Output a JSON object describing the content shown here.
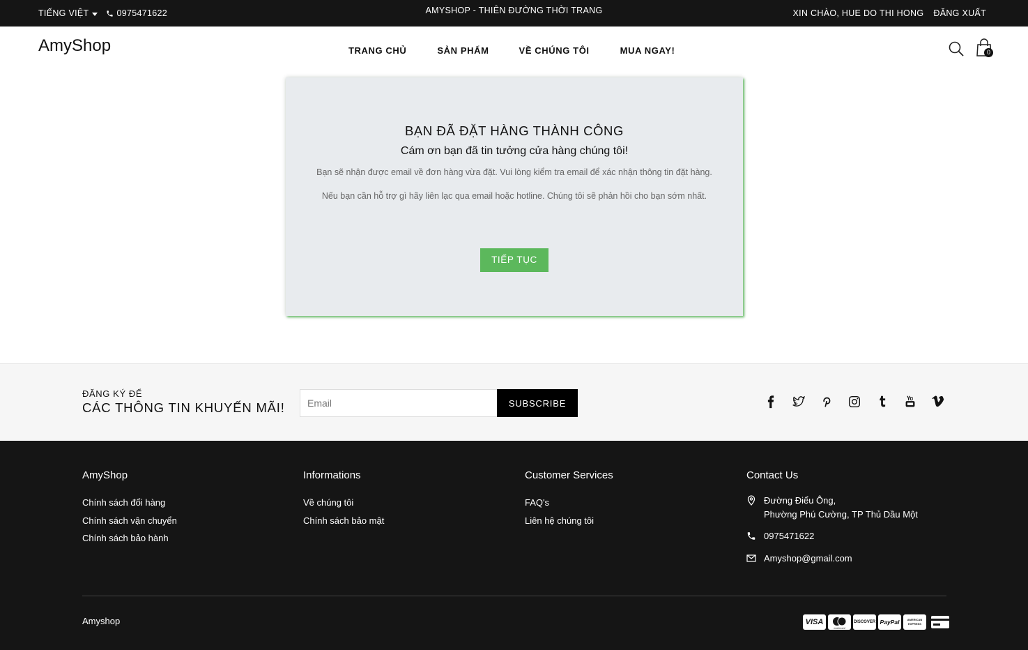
{
  "topbar": {
    "language": "TIẾNG VIỆT",
    "phone": "0975471622",
    "tagline": "AMYSHOP - THIÊN ĐƯỜNG THỜI TRANG",
    "greeting": "XIN CHÀO, HUE DO THI HONG",
    "logout": "ĐĂNG XUẤT"
  },
  "header": {
    "logo": "AmyShop",
    "nav": [
      "TRANG CHỦ",
      "SẢN PHẨM",
      "VỀ CHÚNG TÔI",
      "MUA NGAY!"
    ],
    "cart_count": "0",
    "icons": {
      "search": "search-icon",
      "cart": "shopping-bag-icon"
    }
  },
  "success": {
    "title": "BẠN ĐÃ ĐẶT HÀNG THÀNH CÔNG",
    "thanks": "Cám ơn bạn đã tin tưởng cửa hàng chúng tôi!",
    "message1": "Bạn sẽ nhận được email về đơn hàng vừa đặt. Vui lòng kiểm tra email để xác nhận thông tin đặt hàng.",
    "message2": "Nếu bạn cần hỗ trợ gì hãy liên lạc qua email hoặc hotline. Chúng tôi sẽ phản hồi cho bạn sớm nhất.",
    "button": "TIẾP TỤC",
    "accent_color": "#5cb85c"
  },
  "newsletter": {
    "small_text": "ĐĂNG KÝ ĐỂ",
    "big_text": "CÁC THÔNG TIN KHUYẾN MÃI!",
    "placeholder": "Email",
    "button": "SUBSCRIBE",
    "socials": [
      "facebook-icon",
      "twitter-icon",
      "pinterest-icon",
      "instagram-icon",
      "tumblr-icon",
      "youtube-icon",
      "vimeo-icon"
    ]
  },
  "footer": {
    "col1": {
      "title": "AmyShop",
      "links": [
        "Chính sách đổi hàng",
        "Chính sách vận chuyển",
        "Chính sách bảo hành"
      ]
    },
    "col2": {
      "title": "Informations",
      "links": [
        "Về chúng tôi",
        "Chính sách bảo mật"
      ]
    },
    "col3": {
      "title": "Customer Services",
      "links": [
        "FAQ's",
        "Liên hệ chúng tôi"
      ]
    },
    "contact": {
      "title": "Contact Us",
      "address_line1": "Đường Điểu Ông,",
      "address_line2": "Phường Phú Cường, TP Thủ Dầu Một",
      "phone": "0975471622",
      "email": "Amyshop@gmail.com"
    },
    "copyright": "Amyshop",
    "payments": [
      "VISA",
      "mastercard",
      "DISCOVER",
      "PayPal",
      "AMERICAN EXPRESS",
      "credit-card"
    ]
  }
}
